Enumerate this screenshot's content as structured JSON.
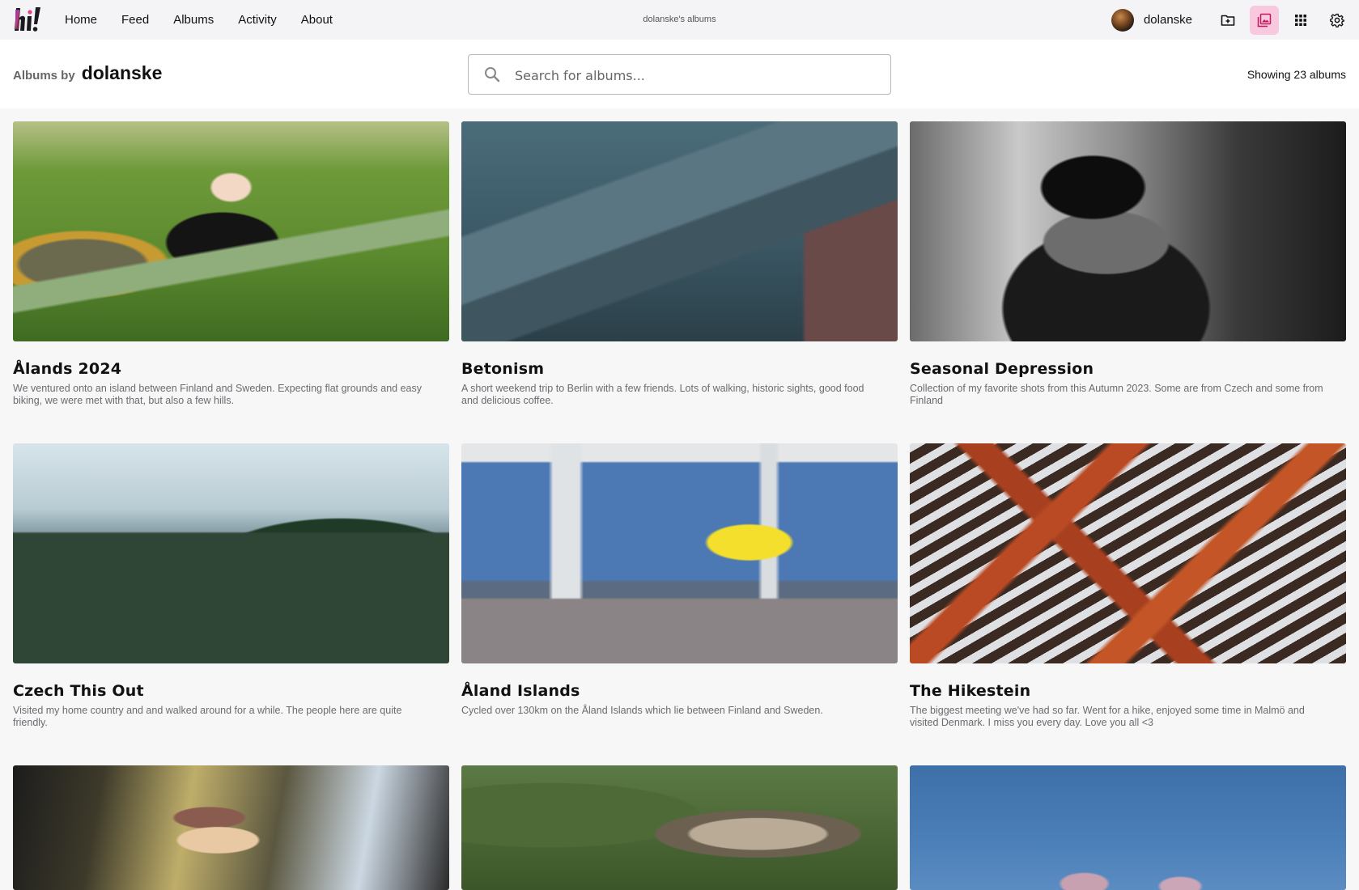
{
  "nav": {
    "links": [
      "Home",
      "Feed",
      "Albums",
      "Activity",
      "About"
    ],
    "center_title": "dolanske's albums",
    "username": "dolanske",
    "icons": [
      "folder-plus-icon",
      "gallery-icon",
      "apps-grid-icon",
      "gear-icon"
    ],
    "accent_color": "#f8c8df"
  },
  "header": {
    "albums_by_label": "Albums by",
    "albums_by_user": "dolanske",
    "search_placeholder": "Search for albums...",
    "search_value": "",
    "showing_text": "Showing 23 albums"
  },
  "albums": [
    {
      "title": "Ålands 2024",
      "description": "We ventured onto an island between Finland and Sweden. Expecting flat grounds and easy biking, we were met with that, but also a few hills."
    },
    {
      "title": "Betonism",
      "description": "A short weekend trip to Berlin with a few friends. Lots of walking, historic sights, good food and delicious coffee."
    },
    {
      "title": "Seasonal Depression",
      "description": "Collection of my favorite shots from this Autumn 2023. Some are from Czech and some from Finland"
    },
    {
      "title": "Czech This Out",
      "description": "Visited my home country and and walked around for a while. The people here are quite friendly."
    },
    {
      "title": "Åland Islands",
      "description": "Cycled over 130km on the Åland Islands which lie between Finland and Sweden."
    },
    {
      "title": "The Hikestein",
      "description": "The biggest meeting we've had so far. Went for a hike, enjoyed some time in Malmö and visited Denmark. I miss you every day. Love you all <3"
    }
  ]
}
